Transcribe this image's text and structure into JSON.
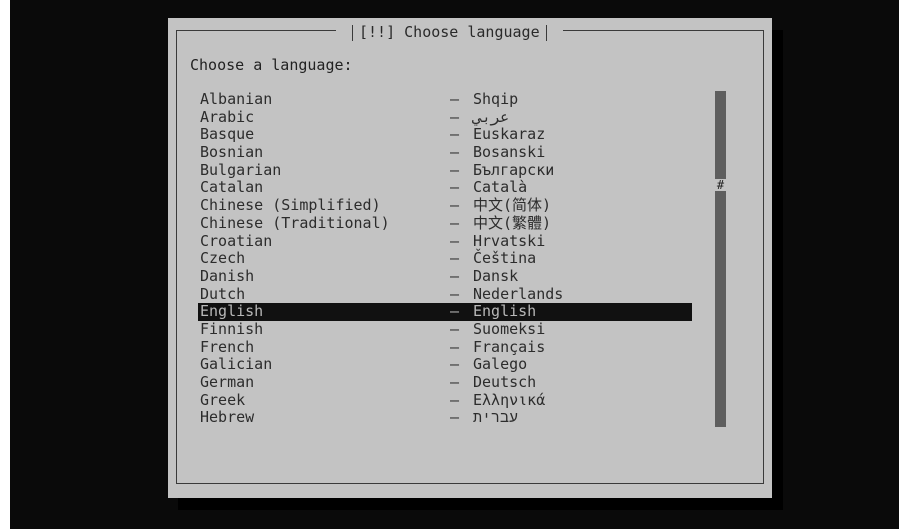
{
  "dialog": {
    "title": "[!!] Choose language",
    "prompt": "Choose a language:"
  },
  "languages": [
    {
      "name": "Albanian",
      "dash": "–",
      "native": "Shqip"
    },
    {
      "name": "Arabic",
      "dash": "–",
      "native": "عربي"
    },
    {
      "name": "Basque",
      "dash": "–",
      "native": "Euskaraz"
    },
    {
      "name": "Bosnian",
      "dash": "–",
      "native": "Bosanski"
    },
    {
      "name": "Bulgarian",
      "dash": "–",
      "native": "Български"
    },
    {
      "name": "Catalan",
      "dash": "–",
      "native": "Català"
    },
    {
      "name": "Chinese (Simplified)",
      "dash": "–",
      "native": "中文(简体)"
    },
    {
      "name": "Chinese (Traditional)",
      "dash": "–",
      "native": "中文(繁體)"
    },
    {
      "name": "Croatian",
      "dash": "–",
      "native": "Hrvatski"
    },
    {
      "name": "Czech",
      "dash": "–",
      "native": "Čeština"
    },
    {
      "name": "Danish",
      "dash": "–",
      "native": "Dansk"
    },
    {
      "name": "Dutch",
      "dash": "–",
      "native": "Nederlands"
    },
    {
      "name": "English",
      "dash": "–",
      "native": "English",
      "selected": true
    },
    {
      "name": "Finnish",
      "dash": "–",
      "native": "Suomeksi"
    },
    {
      "name": "French",
      "dash": "–",
      "native": "Français"
    },
    {
      "name": "Galician",
      "dash": "–",
      "native": "Galego"
    },
    {
      "name": "German",
      "dash": "–",
      "native": "Deutsch"
    },
    {
      "name": "Greek",
      "dash": "–",
      "native": "Ελληνικά"
    },
    {
      "name": "Hebrew",
      "dash": "–",
      "native": "עברית"
    }
  ],
  "scrollbar": {
    "thumb_glyph": "#"
  },
  "colors": {
    "screen_bg": "#0a0a0a",
    "dialog_bg": "#c3c3c3",
    "selection_bg": "#111111",
    "selection_fg": "#b8b8b8",
    "scroll_track": "#5e5e5e"
  }
}
